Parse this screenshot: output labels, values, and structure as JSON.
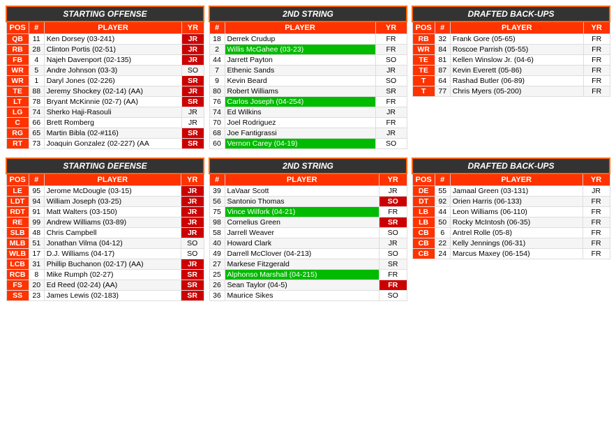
{
  "offense": {
    "header": "STARTING OFFENSE",
    "cols": [
      "POS",
      "#",
      "PLAYER",
      "YR"
    ],
    "rows": [
      {
        "pos": "QB",
        "num": "11",
        "player": "Ken Dorsey (03-241)",
        "yr": "JR",
        "yr_class": "yr-jr",
        "player_class": ""
      },
      {
        "pos": "RB",
        "num": "28",
        "player": "Clinton Portis (02-51)",
        "yr": "JR",
        "yr_class": "yr-jr",
        "player_class": ""
      },
      {
        "pos": "FB",
        "num": "4",
        "player": "Najeh Davenport (02-135)",
        "yr": "JR",
        "yr_class": "yr-jr",
        "player_class": ""
      },
      {
        "pos": "WR",
        "num": "5",
        "player": "Andre Johnson (03-3)",
        "yr": "SO",
        "yr_class": "yr-so",
        "player_class": ""
      },
      {
        "pos": "WR",
        "num": "1",
        "player": "Daryl Jones (02-226)",
        "yr": "SR",
        "yr_class": "yr-sr",
        "player_class": ""
      },
      {
        "pos": "TE",
        "num": "88",
        "player": "Jeremy Shockey (02-14) (AA)",
        "yr": "JR",
        "yr_class": "yr-jr",
        "player_class": ""
      },
      {
        "pos": "LT",
        "num": "78",
        "player": "Bryant McKinnie (02-7) (AA)",
        "yr": "SR",
        "yr_class": "yr-sr",
        "player_class": ""
      },
      {
        "pos": "LG",
        "num": "74",
        "player": "Sherko Haji-Rasouli",
        "yr": "JR",
        "yr_class": "yr-jr-plain",
        "player_class": ""
      },
      {
        "pos": "C",
        "num": "66",
        "player": "Brett Romberg",
        "yr": "JR",
        "yr_class": "yr-jr-plain",
        "player_class": ""
      },
      {
        "pos": "RG",
        "num": "65",
        "player": "Martin Bibla (02-#116)",
        "yr": "SR",
        "yr_class": "yr-sr",
        "player_class": ""
      },
      {
        "pos": "RT",
        "num": "73",
        "player": "Joaquin Gonzalez (02-227) (AA",
        "yr": "SR",
        "yr_class": "yr-sr",
        "player_class": ""
      }
    ]
  },
  "offense2nd": {
    "header": "2ND STRING",
    "cols": [
      "#",
      "PLAYER",
      "YR"
    ],
    "rows": [
      {
        "num": "18",
        "player": "Derrek Crudup",
        "yr": "FR",
        "yr_class": "yr-fr",
        "player_class": ""
      },
      {
        "num": "2",
        "player": "Willis McGahee (03-23)",
        "yr": "FR",
        "yr_class": "yr-fr",
        "player_class": "player-green"
      },
      {
        "num": "44",
        "player": "Jarrett Payton",
        "yr": "SO",
        "yr_class": "yr-so",
        "player_class": ""
      },
      {
        "num": "7",
        "player": "Ethenic Sands",
        "yr": "JR",
        "yr_class": "yr-jr-plain",
        "player_class": ""
      },
      {
        "num": "9",
        "player": "Kevin Beard",
        "yr": "SO",
        "yr_class": "yr-so",
        "player_class": ""
      },
      {
        "num": "80",
        "player": "Robert Williams",
        "yr": "SR",
        "yr_class": "yr-sr-plain",
        "player_class": ""
      },
      {
        "num": "76",
        "player": "Carlos Joseph (04-254)",
        "yr": "FR",
        "yr_class": "yr-fr",
        "player_class": "player-green"
      },
      {
        "num": "74",
        "player": "Ed Wilkins",
        "yr": "JR",
        "yr_class": "yr-jr-plain",
        "player_class": ""
      },
      {
        "num": "70",
        "player": "Joel Rodriguez",
        "yr": "FR",
        "yr_class": "yr-fr",
        "player_class": ""
      },
      {
        "num": "68",
        "player": "Joe Fantigrassi",
        "yr": "JR",
        "yr_class": "yr-jr-plain",
        "player_class": ""
      },
      {
        "num": "60",
        "player": "Vernon Carey (04-19)",
        "yr": "SO",
        "yr_class": "yr-so",
        "player_class": "player-green"
      }
    ]
  },
  "offenseDrafted": {
    "header": "DRAFTED BACK-UPS",
    "cols": [
      "POS",
      "#",
      "PLAYER",
      "YR"
    ],
    "rows": [
      {
        "pos": "RB",
        "num": "32",
        "player": "Frank Gore (05-65)",
        "yr": "FR",
        "yr_class": "yr-fr",
        "player_class": ""
      },
      {
        "pos": "WR",
        "num": "84",
        "player": "Roscoe Parrish (05-55)",
        "yr": "FR",
        "yr_class": "yr-fr",
        "player_class": ""
      },
      {
        "pos": "TE",
        "num": "81",
        "player": "Kellen Winslow Jr. (04-6)",
        "yr": "FR",
        "yr_class": "yr-fr",
        "player_class": ""
      },
      {
        "pos": "TE",
        "num": "87",
        "player": "Kevin Everett (05-86)",
        "yr": "FR",
        "yr_class": "yr-fr",
        "player_class": ""
      },
      {
        "pos": "T",
        "num": "64",
        "player": "Rashad Butler (06-89)",
        "yr": "FR",
        "yr_class": "yr-fr",
        "player_class": ""
      },
      {
        "pos": "T",
        "num": "77",
        "player": "Chris Myers (05-200)",
        "yr": "FR",
        "yr_class": "yr-fr",
        "player_class": ""
      }
    ]
  },
  "defense": {
    "header": "STARTING DEFENSE",
    "cols": [
      "POS",
      "#",
      "PLAYER",
      "YR"
    ],
    "rows": [
      {
        "pos": "LE",
        "num": "95",
        "player": "Jerome McDougle (03-15)",
        "yr": "JR",
        "yr_class": "yr-jr",
        "player_class": ""
      },
      {
        "pos": "LDT",
        "num": "94",
        "player": "William Joseph (03-25)",
        "yr": "JR",
        "yr_class": "yr-jr",
        "player_class": ""
      },
      {
        "pos": "RDT",
        "num": "91",
        "player": "Matt Walters (03-150)",
        "yr": "JR",
        "yr_class": "yr-jr",
        "player_class": ""
      },
      {
        "pos": "RE",
        "num": "99",
        "player": "Andrew Williams (03-89)",
        "yr": "JR",
        "yr_class": "yr-jr",
        "player_class": ""
      },
      {
        "pos": "SLB",
        "num": "48",
        "player": "Chris Campbell",
        "yr": "JR",
        "yr_class": "yr-jr",
        "player_class": ""
      },
      {
        "pos": "MLB",
        "num": "51",
        "player": "Jonathan Vilma (04-12)",
        "yr": "SO",
        "yr_class": "yr-so",
        "player_class": ""
      },
      {
        "pos": "WLB",
        "num": "17",
        "player": "D.J. Williams (04-17)",
        "yr": "SO",
        "yr_class": "yr-so",
        "player_class": ""
      },
      {
        "pos": "LCB",
        "num": "31",
        "player": "Phillip Buchanon (02-17) (AA)",
        "yr": "JR",
        "yr_class": "yr-jr",
        "player_class": ""
      },
      {
        "pos": "RCB",
        "num": "8",
        "player": "Mike Rumph (02-27)",
        "yr": "SR",
        "yr_class": "yr-sr",
        "player_class": ""
      },
      {
        "pos": "FS",
        "num": "20",
        "player": "Ed Reed (02-24) (AA)",
        "yr": "SR",
        "yr_class": "yr-sr",
        "player_class": ""
      },
      {
        "pos": "SS",
        "num": "23",
        "player": "James Lewis (02-183)",
        "yr": "SR",
        "yr_class": "yr-sr",
        "player_class": ""
      }
    ]
  },
  "defense2nd": {
    "header": "2ND STRING",
    "cols": [
      "#",
      "PLAYER",
      "YR"
    ],
    "rows": [
      {
        "num": "39",
        "player": "LaVaar Scott",
        "yr": "JR",
        "yr_class": "yr-jr-plain",
        "player_class": ""
      },
      {
        "num": "56",
        "player": "Santonio Thomas",
        "yr": "SO",
        "yr_class": "yr-so-red",
        "player_class": ""
      },
      {
        "num": "75",
        "player": "Vince Wilfork (04-21)",
        "yr": "FR",
        "yr_class": "yr-fr",
        "player_class": "player-green"
      },
      {
        "num": "98",
        "player": "Cornelius Green",
        "yr": "SR",
        "yr_class": "yr-sr-red",
        "player_class": ""
      },
      {
        "num": "58",
        "player": "Jarrell Weaver",
        "yr": "SO",
        "yr_class": "yr-so",
        "player_class": ""
      },
      {
        "num": "40",
        "player": "Howard Clark",
        "yr": "JR",
        "yr_class": "yr-jr-plain",
        "player_class": ""
      },
      {
        "num": "49",
        "player": "Darrell McClover (04-213)",
        "yr": "SO",
        "yr_class": "yr-so",
        "player_class": ""
      },
      {
        "num": "27",
        "player": "Markese Fitzgerald",
        "yr": "SR",
        "yr_class": "yr-sr-plain",
        "player_class": ""
      },
      {
        "num": "25",
        "player": "Alphonso Marshall (04-215)",
        "yr": "FR",
        "yr_class": "yr-fr",
        "player_class": "player-green"
      },
      {
        "num": "26",
        "player": "Sean Taylor (04-5)",
        "yr": "FR",
        "yr_class": "yr-fr-red",
        "player_class": ""
      },
      {
        "num": "36",
        "player": "Maurice Sikes",
        "yr": "SO",
        "yr_class": "yr-so",
        "player_class": ""
      }
    ]
  },
  "defenseDrafted": {
    "header": "DRAFTED BACK-UPS",
    "cols": [
      "POS",
      "#",
      "PLAYER",
      "YR"
    ],
    "rows": [
      {
        "pos": "DE",
        "num": "55",
        "player": "Jamaal Green (03-131)",
        "yr": "JR",
        "yr_class": "yr-jr-plain",
        "player_class": ""
      },
      {
        "pos": "DT",
        "num": "92",
        "player": "Orien Harris (06-133)",
        "yr": "FR",
        "yr_class": "yr-fr",
        "player_class": ""
      },
      {
        "pos": "LB",
        "num": "44",
        "player": "Leon Williams (06-110)",
        "yr": "FR",
        "yr_class": "yr-fr",
        "player_class": ""
      },
      {
        "pos": "LB",
        "num": "50",
        "player": "Rocky McIntosh (06-35)",
        "yr": "FR",
        "yr_class": "yr-fr",
        "player_class": ""
      },
      {
        "pos": "CB",
        "num": "6",
        "player": "Antrel Rolle (05-8)",
        "yr": "FR",
        "yr_class": "yr-fr",
        "player_class": ""
      },
      {
        "pos": "CB",
        "num": "22",
        "player": "Kelly Jennings (06-31)",
        "yr": "FR",
        "yr_class": "yr-fr",
        "player_class": ""
      },
      {
        "pos": "CB",
        "num": "24",
        "player": "Marcus Maxey (06-154)",
        "yr": "FR",
        "yr_class": "yr-fr",
        "player_class": ""
      }
    ]
  }
}
